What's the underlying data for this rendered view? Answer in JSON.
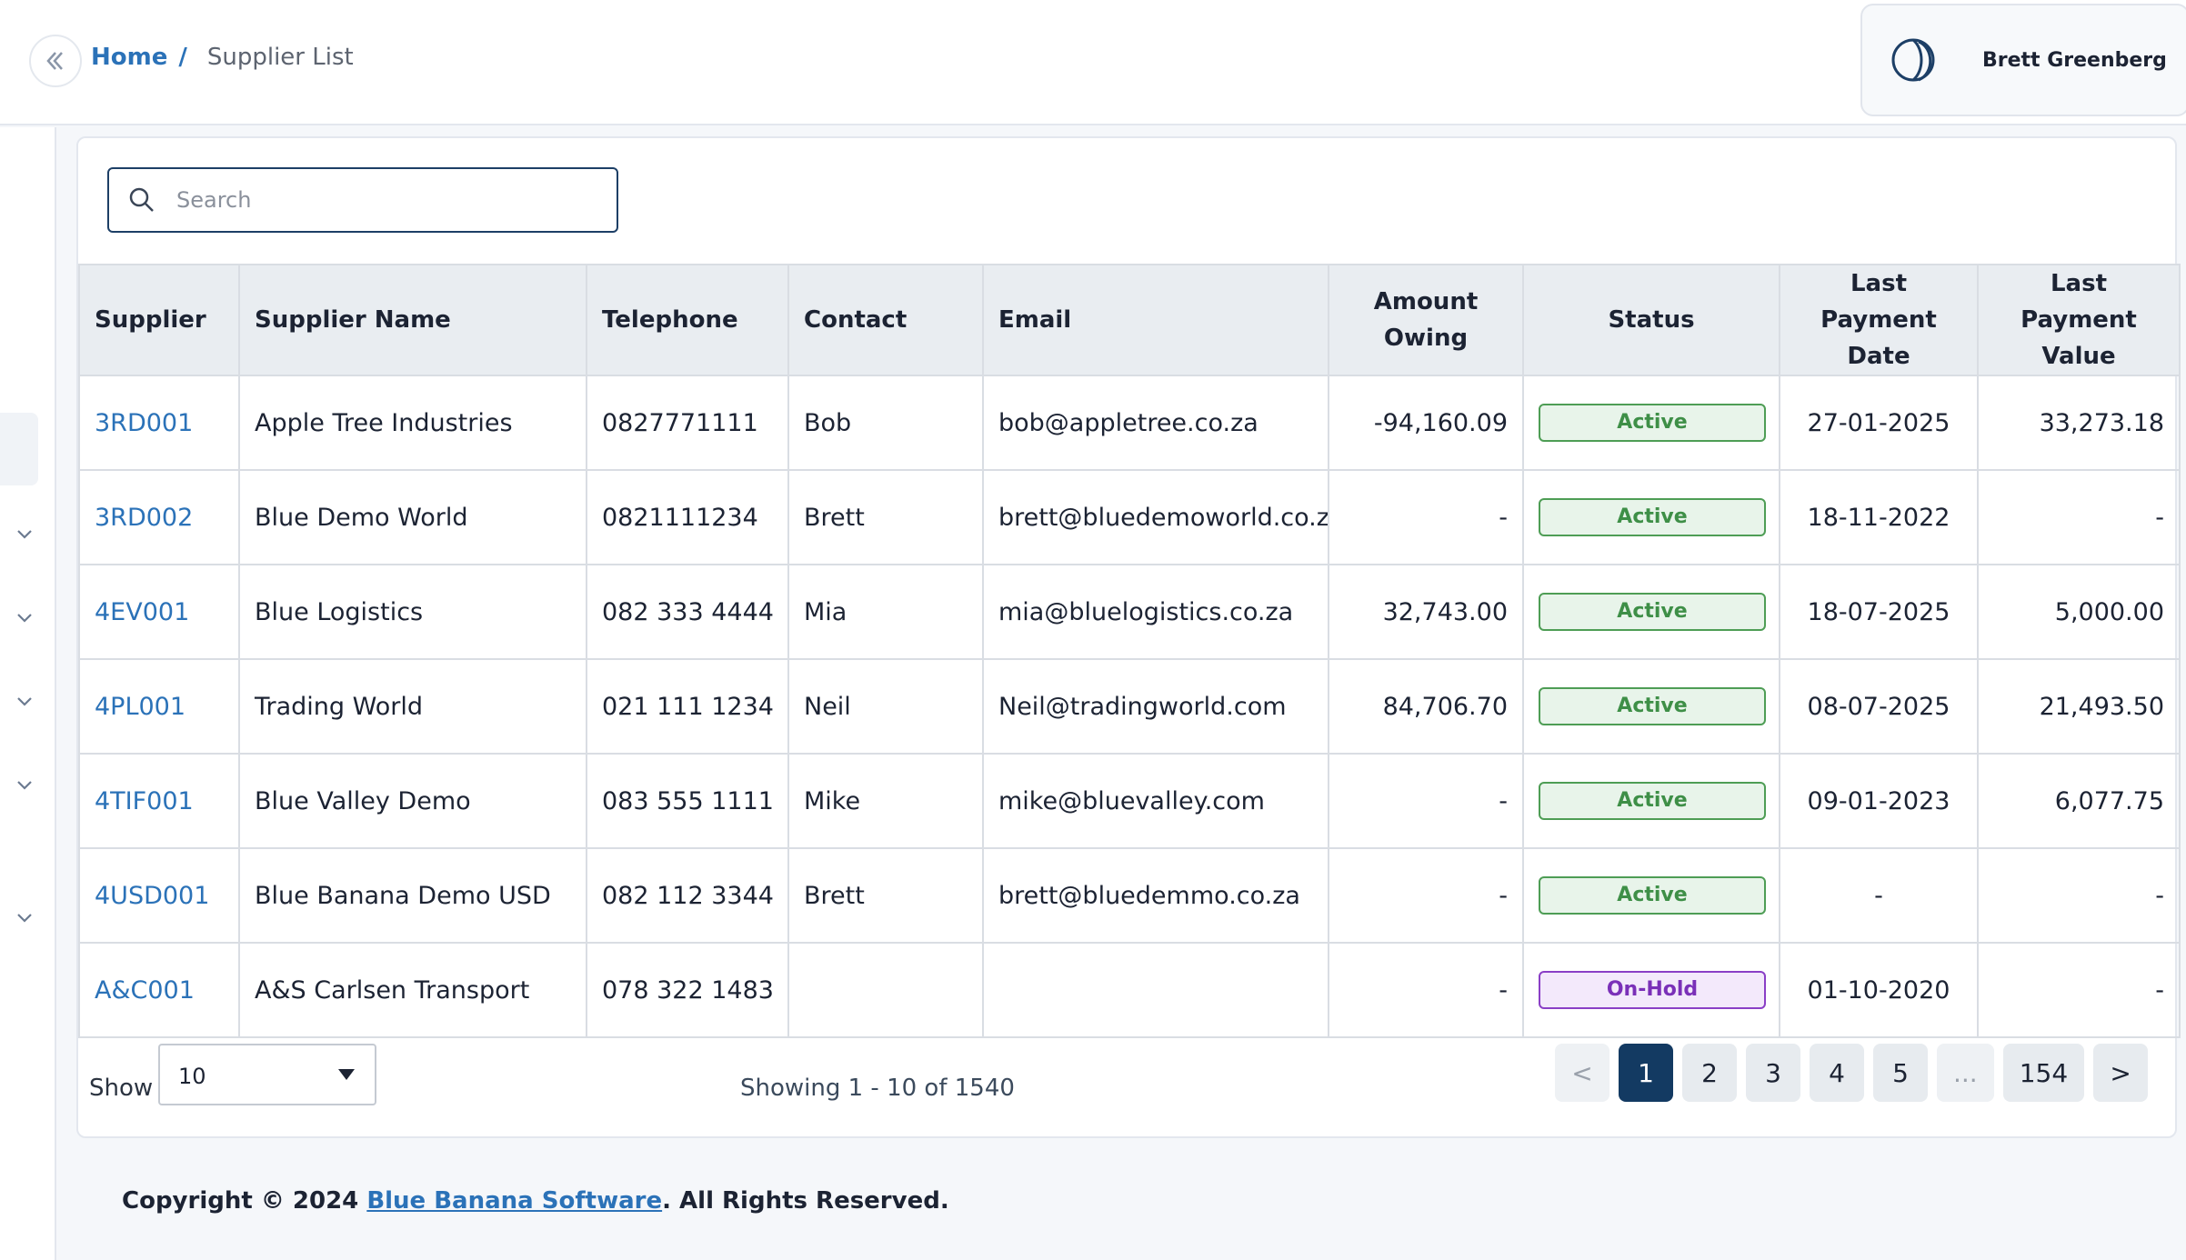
{
  "header": {
    "breadcrumb": {
      "home": "Home",
      "separator": "/",
      "current": "Supplier List"
    },
    "user": {
      "name": "Brett Greenberg"
    }
  },
  "search": {
    "placeholder": "Search",
    "value": ""
  },
  "table": {
    "columns": {
      "supplier": "Supplier",
      "supplier_name": "Supplier Name",
      "telephone": "Telephone",
      "contact": "Contact",
      "email": "Email",
      "amount_owing": "Amount Owing",
      "status": "Status",
      "last_payment_date": "Last Payment Date",
      "last_payment_value": "Last Payment Value"
    },
    "rows": [
      {
        "supplier": "3RD001",
        "name": "Apple Tree Industries",
        "telephone": "0827771111",
        "contact": "Bob",
        "email": "bob@appletree.co.za",
        "amount": "-94,160.09",
        "status": "Active",
        "last_date": "27-01-2025",
        "last_value": "33,273.18"
      },
      {
        "supplier": "3RD002",
        "name": "Blue Demo World",
        "telephone": "0821111234",
        "contact": "Brett",
        "email": "brett@bluedemoworld.co.za",
        "amount": "-",
        "status": "Active",
        "last_date": "18-11-2022",
        "last_value": "-"
      },
      {
        "supplier": "4EV001",
        "name": "Blue Logistics",
        "telephone": "082 333 4444",
        "contact": "Mia",
        "email": "mia@bluelogistics.co.za",
        "amount": "32,743.00",
        "status": "Active",
        "last_date": "18-07-2025",
        "last_value": "5,000.00"
      },
      {
        "supplier": "4PL001",
        "name": "Trading World",
        "telephone": "021 111 1234",
        "contact": "Neil",
        "email": "Neil@tradingworld.com",
        "amount": "84,706.70",
        "status": "Active",
        "last_date": "08-07-2025",
        "last_value": "21,493.50"
      },
      {
        "supplier": "4TIF001",
        "name": "Blue Valley Demo",
        "telephone": "083 555 1111",
        "contact": "Mike",
        "email": "mike@bluevalley.com",
        "amount": "-",
        "status": "Active",
        "last_date": "09-01-2023",
        "last_value": "6,077.75"
      },
      {
        "supplier": "4USD001",
        "name": "Blue Banana Demo USD",
        "telephone": "082 112 3344",
        "contact": "Brett",
        "email": "brett@bluedemmo.co.za",
        "amount": "-",
        "status": "Active",
        "last_date": "-",
        "last_value": "-"
      },
      {
        "supplier": "A&C001",
        "name": "A&S Carlsen Transport",
        "telephone": "078 322 1483",
        "contact": "",
        "email": "",
        "amount": "-",
        "status": "On-Hold",
        "last_date": "01-10-2020",
        "last_value": "-"
      }
    ]
  },
  "pagination": {
    "show_label": "Show",
    "page_size": "10",
    "showing_text": "Showing 1 - 10 of 1540",
    "prev": "<",
    "next": ">",
    "pages": [
      "1",
      "2",
      "3",
      "4",
      "5",
      "...",
      "154"
    ],
    "current_page": "1"
  },
  "footer": {
    "prefix": "Copyright © 2024 ",
    "company_link": "Blue Banana Software",
    "suffix": ". All Rights Reserved."
  },
  "colors": {
    "link": "#2b72b8",
    "active_badge": "#4e9d55",
    "onhold_badge": "#8a3fc6",
    "current_page": "#133a62"
  }
}
